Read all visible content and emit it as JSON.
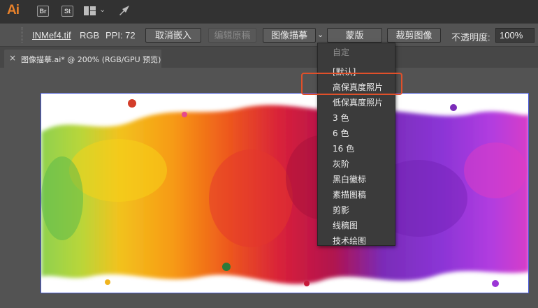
{
  "app": {
    "logo": "Ai",
    "bridge_label": "Br",
    "stock_label": "St",
    "icons": [
      "arrange-documents-icon",
      "chevron-down-icon",
      "gpu-performance-icon"
    ]
  },
  "control_bar": {
    "filename": "INMef4.tif",
    "color_mode": "RGB",
    "ppi": "PPI: 72",
    "unembed_label": "取消嵌入",
    "edit_original_label": "编辑原稿",
    "image_trace_label": "图像描摹",
    "mask_label": "蒙版",
    "crop_label": "裁剪图像",
    "opacity_label": "不透明度:",
    "opacity_value": "100%"
  },
  "document_tab": {
    "close_glyph": "×",
    "title": "图像描摹.ai* @ 200% (RGB/GPU 预览)"
  },
  "trace_menu": {
    "items": [
      {
        "label": "自定",
        "disabled": true
      },
      {
        "label": "[默认]",
        "disabled": false
      },
      {
        "label": "高保真度照片",
        "disabled": false,
        "highlighted": true
      },
      {
        "label": "低保真度照片",
        "disabled": false
      },
      {
        "label": "3 色",
        "disabled": false
      },
      {
        "label": "6 色",
        "disabled": false
      },
      {
        "label": "16 色",
        "disabled": false
      },
      {
        "label": "灰阶",
        "disabled": false
      },
      {
        "label": "黑白徽标",
        "disabled": false
      },
      {
        "label": "素描图稿",
        "disabled": false
      },
      {
        "label": "剪影",
        "disabled": false
      },
      {
        "label": "线稿图",
        "disabled": false
      },
      {
        "label": "技术绘图",
        "disabled": false
      }
    ]
  },
  "colors": {
    "brand": "#e9822b",
    "highlight": "#e0502a",
    "selection": "#4a5bd6"
  },
  "artwork": {
    "description_icon": "watercolor-splash-image"
  }
}
